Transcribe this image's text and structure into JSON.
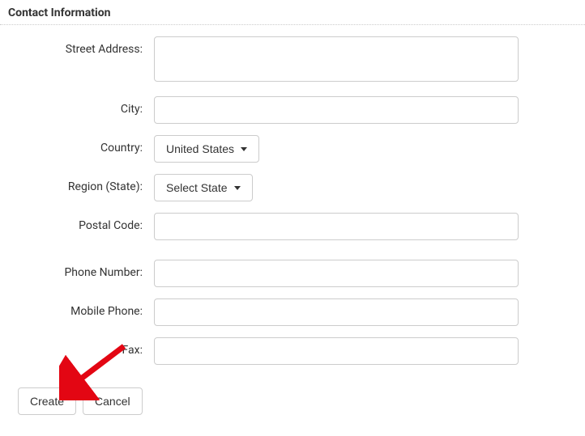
{
  "section": {
    "title": "Contact Information"
  },
  "fields": {
    "street_address": {
      "label": "Street Address:",
      "value": ""
    },
    "city": {
      "label": "City:",
      "value": ""
    },
    "country": {
      "label": "Country:",
      "selected": "United States"
    },
    "region": {
      "label": "Region (State):",
      "selected": "Select State"
    },
    "postal_code": {
      "label": "Postal Code:",
      "value": ""
    },
    "phone_number": {
      "label": "Phone Number:",
      "value": ""
    },
    "mobile_phone": {
      "label": "Mobile Phone:",
      "value": ""
    },
    "fax": {
      "label": "Fax:",
      "value": ""
    }
  },
  "buttons": {
    "create": "Create",
    "cancel": "Cancel"
  }
}
